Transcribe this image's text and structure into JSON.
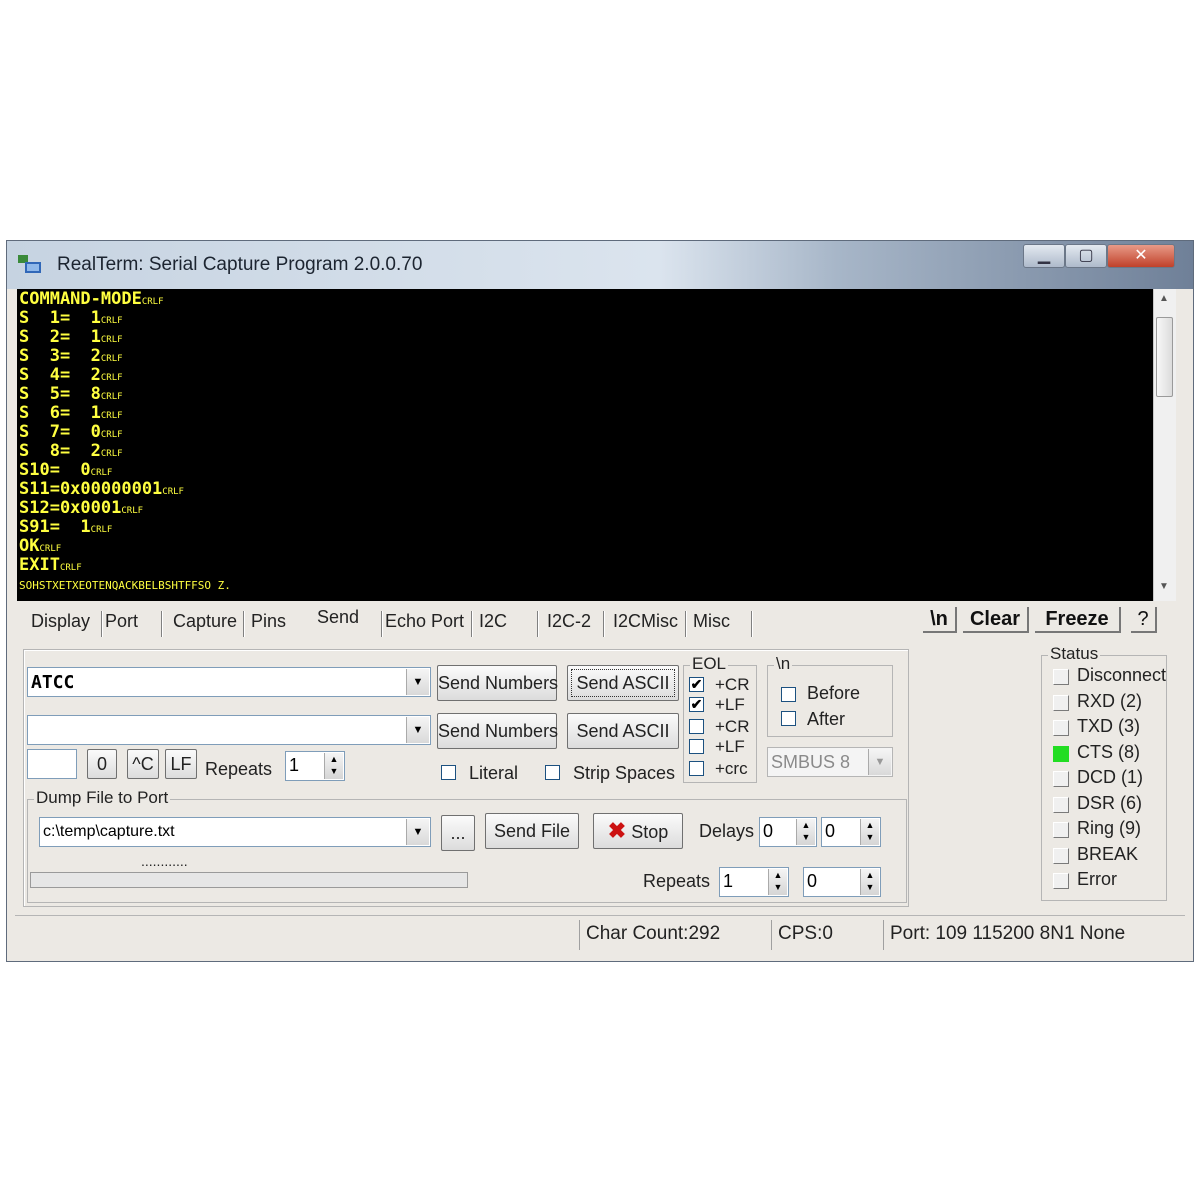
{
  "window": {
    "title": "RealTerm: Serial Capture Program 2.0.0.70"
  },
  "terminal": {
    "lines": [
      {
        "text": "COMMAND-MODE",
        "ctl": "CRLF"
      },
      {
        "text": "S  1=  1",
        "ctl": "CRLF"
      },
      {
        "text": "S  2=  1",
        "ctl": "CRLF"
      },
      {
        "text": "S  3=  2",
        "ctl": "CRLF"
      },
      {
        "text": "S  4=  2",
        "ctl": "CRLF"
      },
      {
        "text": "S  5=  8",
        "ctl": "CRLF"
      },
      {
        "text": "S  6=  1",
        "ctl": "CRLF"
      },
      {
        "text": "S  7=  0",
        "ctl": "CRLF"
      },
      {
        "text": "S  8=  2",
        "ctl": "CRLF"
      },
      {
        "text": "S10=  0",
        "ctl": "CRLF"
      },
      {
        "text": "S11=0x00000001",
        "ctl": "CRLF"
      },
      {
        "text": "S12=0x0001",
        "ctl": "CRLF"
      },
      {
        "text": "S91=  1",
        "ctl": "CRLF"
      },
      {
        "text": "OK",
        "ctl": "CRLF"
      },
      {
        "text": "EXIT",
        "ctl": "CRLF"
      },
      {
        "text": "",
        "ctl": "SOHSTXETXEOTENQACKBELBSHTFFSO Z.",
        "garbage": true
      }
    ]
  },
  "tabs": [
    "Display",
    "Port",
    "Capture",
    "Pins",
    "Send",
    "Echo Port",
    "I2C",
    "I2C-2",
    "I2CMisc",
    "Misc"
  ],
  "selected_tab": "Send",
  "toolbar": {
    "newline": "\\n",
    "clear": "Clear",
    "freeze": "Freeze",
    "help": "?"
  },
  "send": {
    "line1": {
      "value": "ATCC",
      "send_numbers": "Send Numbers",
      "send_ascii": "Send ASCII"
    },
    "line2": {
      "value": "",
      "send_numbers": "Send Numbers",
      "send_ascii": "Send ASCII"
    },
    "char_input": "",
    "btn_zero": "0",
    "btn_ctrl_c": "^C",
    "btn_lf": "LF",
    "repeats_label": "Repeats",
    "repeats_value": "1",
    "literal_label": "Literal",
    "strip_spaces_label": "Strip Spaces",
    "eol": {
      "title": "EOL",
      "cr1": "+CR",
      "lf1": "+LF",
      "cr2": "+CR",
      "lf2": "+LF",
      "crc": "+crc",
      "cr1_checked": true,
      "lf1_checked": true,
      "cr2_checked": false,
      "lf2_checked": false,
      "crc_checked": false
    },
    "newline_group": {
      "title": "\\n",
      "before": "Before",
      "after": "After"
    },
    "smbus": "SMBUS 8"
  },
  "dump": {
    "title": "Dump File to Port",
    "file": "c:\\temp\\capture.txt",
    "browse": "...",
    "send_file": "Send File",
    "stop": "Stop",
    "delays_label": "Delays",
    "delay1": "0",
    "delay2": "0",
    "progress_text": "............",
    "repeats_label": "Repeats",
    "repeats1": "1",
    "repeats2": "0"
  },
  "status": {
    "title": "Status",
    "items": [
      {
        "label": "Disconnect",
        "on": false
      },
      {
        "label": "RXD (2)",
        "on": false
      },
      {
        "label": "TXD (3)",
        "on": false
      },
      {
        "label": "CTS (8)",
        "on": true
      },
      {
        "label": "DCD (1)",
        "on": false
      },
      {
        "label": "DSR (6)",
        "on": false
      },
      {
        "label": "Ring (9)",
        "on": false
      },
      {
        "label": "BREAK",
        "on": false
      },
      {
        "label": "Error",
        "on": false
      }
    ],
    "led_on_color": "#22dd22"
  },
  "statusbar": {
    "char_count": "Char Count:292",
    "cps": "CPS:0",
    "port": "Port: 109 115200 8N1 None"
  }
}
